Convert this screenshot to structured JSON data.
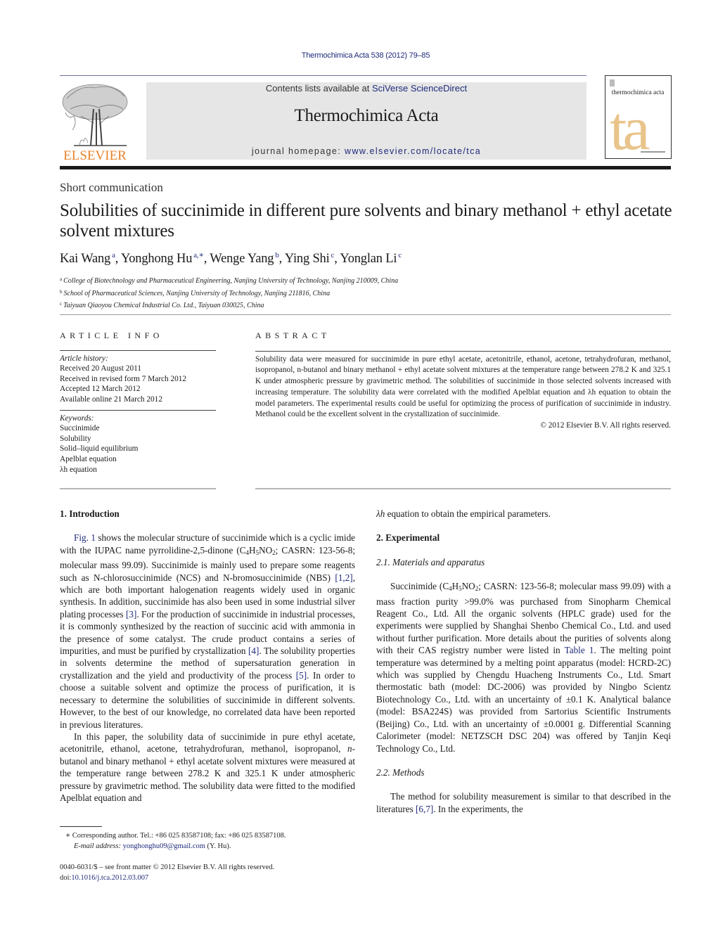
{
  "header": {
    "journal_ref": "Thermochimica Acta 538 (2012) 79–85",
    "contents_prefix": "Contents lists available at ",
    "contents_link": "SciVerse ScienceDirect",
    "journal_title": "Thermochimica Acta",
    "homepage_prefix": "journal homepage: ",
    "homepage_url": "www.elsevier.com/locate/tca",
    "publisher_logo_text": "ELSEVIER",
    "cover_title": "thermochimica acta",
    "cover_letters": "ta",
    "colors": {
      "link": "#1f2a7a",
      "elsevier_orange": "#e8822a",
      "cover_tan": "#e9c48a",
      "banner_gray": "#e6e6e6"
    }
  },
  "article": {
    "type": "Short communication",
    "title": "Solubilities of succinimide in different pure solvents and binary methanol + ethyl acetate solvent mixtures",
    "authors": [
      {
        "name": "Kai Wang",
        "sup": "a"
      },
      {
        "name": "Yonghong Hu",
        "sup": "a,∗"
      },
      {
        "name": "Wenge Yang",
        "sup": "b"
      },
      {
        "name": "Ying Shi",
        "sup": "c"
      },
      {
        "name": "Yonglan Li",
        "sup": "c"
      }
    ],
    "affiliations": [
      {
        "key": "a",
        "text": "College of Biotechnology and Pharmaceutical Engineering, Nanjing University of Technology, Nanjing 210009, China"
      },
      {
        "key": "b",
        "text": "School of Pharmaceutical Sciences, Nanjing University of Technology, Nanjing 211816, China"
      },
      {
        "key": "c",
        "text": "Taiyuan Qiaoyou Chemical Industrial Co. Ltd., Taiyuan 030025, China"
      }
    ]
  },
  "article_info": {
    "heading": "ARTICLE INFO",
    "history_label": "Article history:",
    "history": [
      "Received 20 August 2011",
      "Received in revised form 7 March 2012",
      "Accepted 12 March 2012",
      "Available online 21 March 2012"
    ],
    "keywords_label": "Keywords:",
    "keywords": [
      "Succinimide",
      "Solubility",
      "Solid–liquid equilibrium",
      "Apelblat equation",
      "λh equation"
    ]
  },
  "abstract": {
    "heading": "ABSTRACT",
    "text": "Solubility data were measured for succinimide in pure ethyl acetate, acetonitrile, ethanol, acetone, tetrahydrofuran, methanol, isopropanol, n-butanol and binary methanol + ethyl acetate solvent mixtures at the temperature range between 278.2 K and 325.1 K under atmospheric pressure by gravimetric method. The solubilities of succinimide in those selected solvents increased with increasing temperature. The solubility data were correlated with the modified Apelblat equation and λh equation to obtain the model parameters. The experimental results could be useful for optimizing the process of purification of succinimide in industry. Methanol could be the excellent solvent in the crystallization of succinimide.",
    "copyright": "© 2012 Elsevier B.V. All rights reserved."
  },
  "body": {
    "intro_heading": "1.  Introduction",
    "intro_p1_link": "Fig. 1",
    "intro_p1_a": " shows the molecular structure of succinimide which is a cyclic imide with the IUPAC name pyrrolidine-2,5-dinone (C",
    "intro_p1_b": "; CASRN: 123-56-8; molecular mass 99.09). Succinimide is mainly used to prepare some reagents such as N-chlorosuccinimide (NCS) and N-bromosuccinimide (NBS) ",
    "ref_1_2": "[1,2]",
    "intro_p1_c": ", which are both important halogenation reagents widely used in organic synthesis. In addition, succinimide has also been used in some industrial silver plating processes ",
    "ref_3": "[3]",
    "intro_p1_d": ". For the production of succinimide in industrial processes, it is commonly synthesized by the reaction of succinic acid with ammonia in the presence of some catalyst. The crude product contains a series of impurities, and must be purified by crystallization ",
    "ref_4": "[4]",
    "intro_p1_e": ". The solubility properties in solvents determine the method of supersaturation generation in crystallization and the yield and productivity of the process ",
    "ref_5": "[5]",
    "intro_p1_f": ". In order to choose a suitable solvent and optimize the process of purification, it is necessary to determine the solubilities of succinimide in different solvents. However, to the best of our knowledge, no correlated data have been reported in previous literatures.",
    "intro_p2_a": "In this paper, the solubility data of succinimide in pure ethyl acetate, acetonitrile, ethanol, acetone, tetrahydrofuran, methanol, isopropanol, ",
    "intro_p2_n": "n",
    "intro_p2_b": "-butanol and binary methanol + ethyl acetate solvent mixtures were measured at the temperature range between 278.2 K and 325.1 K under atmospheric pressure by gravimetric method. The solubility data were fitted to the modified Apelblat equation and ",
    "intro_p2_lh": "λh",
    "intro_p2_c": " equation to obtain the empirical parameters.",
    "exp_heading": "2.  Experimental",
    "mat_heading": "2.1.  Materials and apparatus",
    "mat_p_a": "Succinimide (C",
    "mat_p_b": "; CASRN: 123-56-8; molecular mass 99.09) with a mass fraction purity >99.0% was purchased from Sinopharm Chemical Reagent Co., Ltd. All the organic solvents (HPLC grade) used for the experiments were supplied by Shanghai Shenbo Chemical Co., Ltd. and used without further purification. More details about the purities of solvents along with their CAS registry number were listed in ",
    "table1_link": "Table 1",
    "mat_p_c": ". The melting point temperature was determined by a melting point apparatus (model: HCRD-2C) which was supplied by Chengdu Huacheng Instruments Co., Ltd. Smart thermostatic bath (model: DC-2006) was provided by Ningbo Scientz Biotechnology Co., Ltd. with an uncertainty of ±0.1 K. Analytical balance (model: BSA224S) was provided from Sartorius Scientific Instruments (Beijing) Co., Ltd. with an uncertainty of ±0.0001 g. Differential Scanning Calorimeter (model: NETZSCH DSC 204) was offered by Tanjin Keqi Technology Co., Ltd.",
    "methods_heading": "2.2.  Methods",
    "methods_p_a": "The method for solubility measurement is similar to that described in the literatures ",
    "ref_6_7": "[6,7]",
    "methods_p_b": ". In the experiments, the",
    "formula": {
      "c": "4",
      "h": "H",
      "h_n": "5",
      "no": "NO",
      "no_n": "2"
    }
  },
  "footnote": {
    "marker": "∗",
    "corresponding": " Corresponding author. Tel.: +86 025 83587108; fax: +86 025 83587108.",
    "email_label": "E-mail address:",
    "email": "yonghonghu09@gmail.com",
    "email_suffix": " (Y. Hu)."
  },
  "bottom_meta": {
    "issn_line": "0040-6031/$ – see front matter © 2012 Elsevier B.V. All rights reserved.",
    "doi_prefix": "doi:",
    "doi": "10.1016/j.tca.2012.03.007"
  }
}
